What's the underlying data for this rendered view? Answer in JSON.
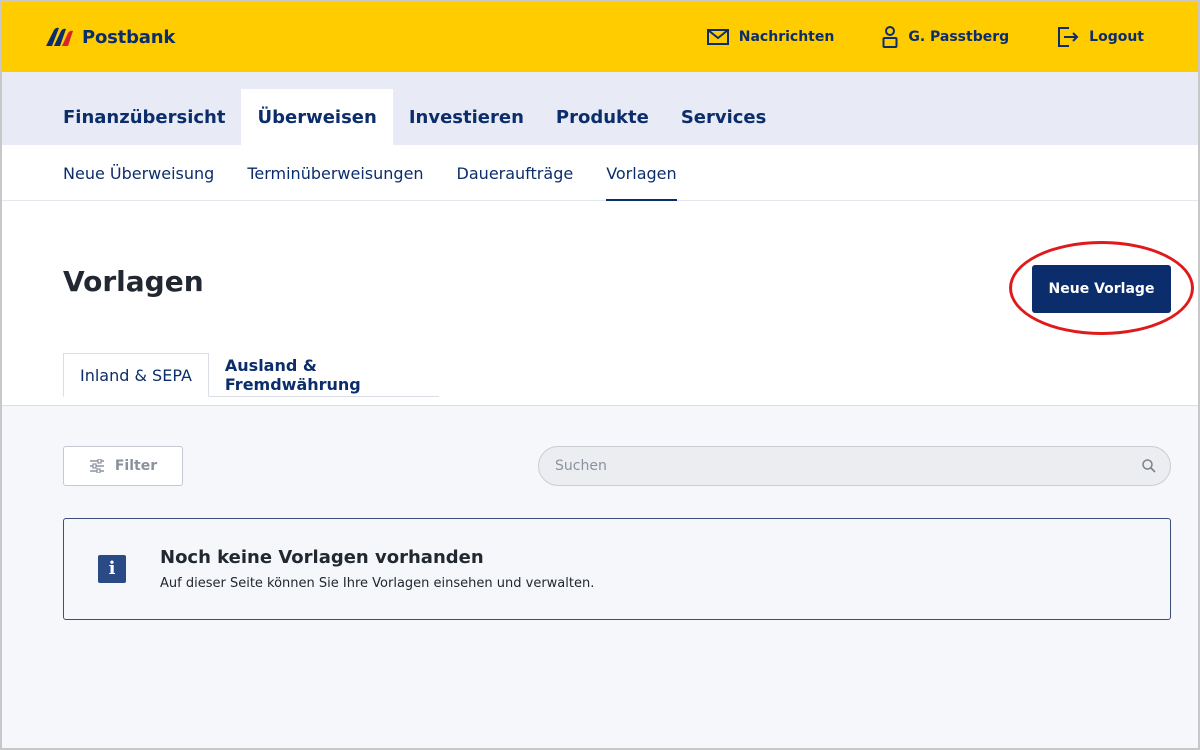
{
  "header": {
    "logo_text": "Postbank",
    "messages_label": "Nachrichten",
    "user_label": "G. Passtberg",
    "logout_label": "Logout"
  },
  "main_nav": {
    "items": [
      "Finanzübersicht",
      "Überweisen",
      "Investieren",
      "Produkte",
      "Services"
    ],
    "active": "Überweisen"
  },
  "sub_nav": {
    "items": [
      "Neue Überweisung",
      "Terminüberweisungen",
      "Daueraufträge",
      "Vorlagen"
    ],
    "active": "Vorlagen"
  },
  "page": {
    "title": "Vorlagen",
    "primary_button": "Neue Vorlage"
  },
  "tabs": {
    "items": [
      "Inland & SEPA",
      "Ausland & Fremdwährung"
    ],
    "active": "Inland & SEPA"
  },
  "toolbar": {
    "filter_label": "Filter",
    "search_placeholder": "Suchen"
  },
  "info": {
    "title": "Noch keine Vorlagen vorhanden",
    "text": "Auf dieser Seite können Sie Ihre Vorlagen einsehen und verwalten."
  },
  "colors": {
    "brand_yellow": "#ffcc00",
    "brand_navy": "#0c2d6b",
    "highlight_red": "#e01a1a"
  }
}
